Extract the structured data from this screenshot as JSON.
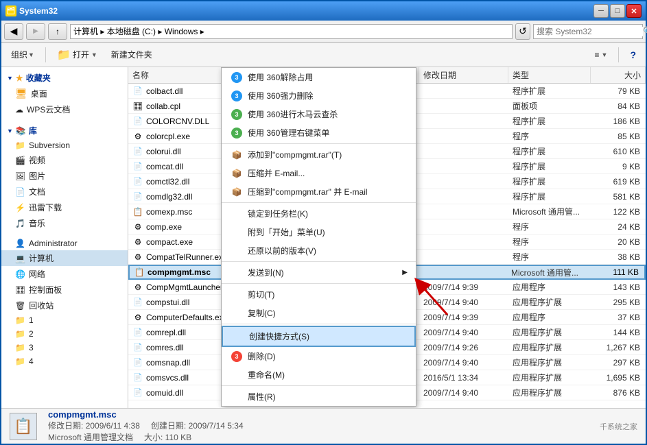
{
  "window": {
    "title": "System32",
    "titlebar_icon": "🗂"
  },
  "addressbar": {
    "path": "计算机 ▸ 本地磁盘 (C:) ▸ Windows ▸",
    "search_placeholder": "搜索 System32",
    "back_label": "◀",
    "forward_label": "▶",
    "up_label": "↑"
  },
  "toolbar": {
    "organize": "组织",
    "open": "打开",
    "new_folder": "新建文件夹",
    "view_label": "≡",
    "help_label": "?"
  },
  "sidebar": {
    "favorites_label": "收藏夹",
    "desktop_label": "桌面",
    "wps_label": "WPS云文档",
    "library_label": "库",
    "subversion_label": "Subversion",
    "video_label": "视频",
    "picture_label": "图片",
    "document_label": "文档",
    "thunder_label": "迅雷下载",
    "music_label": "音乐",
    "admin_label": "Administrator",
    "computer_label": "计算机",
    "network_label": "网络",
    "control_label": "控制面板",
    "recycle_label": "回收站",
    "f1_label": "1",
    "f2_label": "2",
    "f3_label": "3",
    "f4_label": "4"
  },
  "columns": {
    "name": "名称",
    "date": "修改日期",
    "type": "类型",
    "size": "大小"
  },
  "files": [
    {
      "name": "colbact.dll",
      "date": "",
      "type": "程序扩展",
      "size": ""
    },
    {
      "name": "collab.cpl",
      "date": "",
      "type": "面板项",
      "size": "84 KB"
    },
    {
      "name": "COLORCNV.DLL",
      "date": "",
      "type": "程序扩展",
      "size": "186 KB"
    },
    {
      "name": "colorcpl.exe",
      "date": "",
      "type": "程序",
      "size": "85 KB"
    },
    {
      "name": "colorui.dll",
      "date": "",
      "type": "程序扩展",
      "size": "610 KB"
    },
    {
      "name": "comcat.dll",
      "date": "",
      "type": "程序扩展",
      "size": "9 KB"
    },
    {
      "name": "comctl32.dll",
      "date": "",
      "type": "程序扩展",
      "size": "619 KB"
    },
    {
      "name": "comdlg32.dll",
      "date": "",
      "type": "程序扩展",
      "size": "581 KB"
    },
    {
      "name": "comexp.msc",
      "date": "",
      "type": "Microsoft 通用管...",
      "size": "122 KB"
    },
    {
      "name": "comp.exe",
      "date": "",
      "type": "程序",
      "size": "24 KB"
    },
    {
      "name": "compact.exe",
      "date": "",
      "type": "程序",
      "size": "20 KB"
    },
    {
      "name": "CompatTelRunner.exe",
      "date": "",
      "type": "程序",
      "size": "38 KB"
    },
    {
      "name": "compmgmt.msc",
      "date": "",
      "type": "Microsoft 通用管...",
      "size": "111 KB",
      "highlighted": true
    },
    {
      "name": "CompMgmtLauncher.exe",
      "date": "2009/7/14 9:39",
      "type": "应用程序",
      "size": "143 KB"
    },
    {
      "name": "compstui.dll",
      "date": "2009/7/14 9:40",
      "type": "应用程序扩展",
      "size": "295 KB"
    },
    {
      "name": "ComputerDefaults.exe",
      "date": "2009/7/14 9:39",
      "type": "应用程序",
      "size": "37 KB"
    },
    {
      "name": "comrepl.dll",
      "date": "2009/7/14 9:40",
      "type": "应用程序扩展",
      "size": "144 KB"
    },
    {
      "name": "comres.dll",
      "date": "2009/7/14 9:26",
      "type": "应用程序扩展",
      "size": "1,267 KB"
    },
    {
      "name": "comsnap.dll",
      "date": "2009/7/14 9:40",
      "type": "应用程序扩展",
      "size": "297 KB"
    },
    {
      "name": "comsvcs.dll",
      "date": "2016/5/1 13:34",
      "type": "应用程序扩展",
      "size": "1,695 KB"
    },
    {
      "name": "comuid.dll",
      "date": "2009/7/14 9:40",
      "type": "应用程序扩展",
      "size": "876 KB"
    }
  ],
  "context_menu": {
    "items": [
      {
        "label": "使用 360解除占用",
        "icon": "360b",
        "type": "action"
      },
      {
        "label": "使用 360强力删除",
        "icon": "360b",
        "type": "action"
      },
      {
        "label": "使用 360进行木马云查杀",
        "icon": "360g",
        "type": "action"
      },
      {
        "label": "使用 360管理右键菜单",
        "icon": "360g",
        "type": "action"
      },
      {
        "separator": true
      },
      {
        "label": "添加到\"compmgmt.rar\"(T)",
        "icon": "zip",
        "type": "action"
      },
      {
        "label": "压缩并 E-mail...",
        "icon": "zip",
        "type": "action"
      },
      {
        "label": "压缩到\"compmgmt.rar\" 并 E-mail",
        "icon": "zip",
        "type": "action"
      },
      {
        "separator": true
      },
      {
        "label": "锁定到任务栏(K)",
        "type": "action"
      },
      {
        "label": "附到「开始」菜单(U)",
        "type": "action"
      },
      {
        "label": "还原以前的版本(V)",
        "type": "action"
      },
      {
        "separator": true
      },
      {
        "label": "发送到(N)",
        "type": "submenu",
        "arrow": true
      },
      {
        "separator": true
      },
      {
        "label": "剪切(T)",
        "type": "action"
      },
      {
        "label": "复制(C)",
        "type": "action"
      },
      {
        "separator": true
      },
      {
        "label": "创建快捷方式(S)",
        "type": "action",
        "highlighted": true
      },
      {
        "label": "删除(D)",
        "icon": "360r",
        "type": "action"
      },
      {
        "label": "重命名(M)",
        "type": "action"
      },
      {
        "separator": true
      },
      {
        "label": "属性(R)",
        "type": "action"
      }
    ]
  },
  "status_bar": {
    "filename": "compmgmt.msc",
    "modify_label": "修改日期:",
    "modify_date": "2009/6/11 4:38",
    "create_label": "创建日期:",
    "create_date": "2009/7/14 5:34",
    "type_label": "Microsoft 通用管理文档",
    "size_label": "大小: 110 KB"
  },
  "watermark": "千系统之家",
  "colors": {
    "accent": "#0054a6",
    "highlight_bg": "#cde4f5",
    "highlight_border": "#4488cc",
    "ctx_highlight": "#ddeeff"
  }
}
